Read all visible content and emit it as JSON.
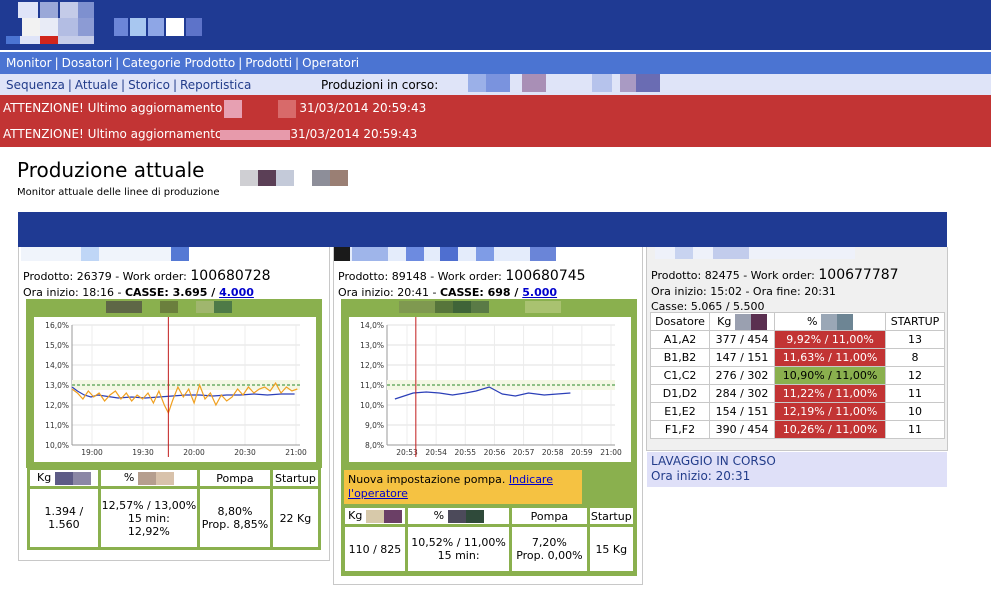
{
  "nav": {
    "main": [
      "Monitor",
      "Dosatori",
      "Categorie Prodotto",
      "Prodotti",
      "Operatori"
    ],
    "sub": [
      "Sequenza",
      "Attuale",
      "Storico",
      "Reportistica"
    ],
    "production_label": "Produzioni in corso:"
  },
  "alerts": [
    {
      "prefix": "ATTENZIONE! Ultimo aggiornamento",
      "time": "31/03/2014 20:59:43"
    },
    {
      "prefix": "ATTENZIONE! Ultimo aggiornamento",
      "time": "31/03/2014 20:59:43"
    }
  ],
  "page": {
    "title": "Produzione attuale",
    "subtitle": "Monitor attuale delle linee di produzione"
  },
  "lines": [
    {
      "prodotto": "Prodotto: 26379 - Work order:",
      "work_order": "100680728",
      "ora_inizio": "Ora inizio: 18:16 - ",
      "casse_label": "CASSE: 3.695 / ",
      "casse_target": "4.000",
      "kg_label": "Kg",
      "pct_label": "%",
      "pompa_label": "Pompa",
      "startup_label": "Startup",
      "kg_value": "1.394 / 1.560",
      "pct_value": "12,57% / 13,00%",
      "pct_15": "15 min:",
      "pct_15_value": "12,92%",
      "pompa_value": "8,80%",
      "pompa_prop": "Prop. 8,85%",
      "startup_value": "22 Kg"
    },
    {
      "prodotto": "Prodotto: 89148 - Work order:",
      "work_order": "100680745",
      "ora_inizio": "Ora inizio: 20:41 - ",
      "casse_label": "CASSE: 698 / ",
      "casse_target": "5.000",
      "notice_text": "Nuova impostazione pompa.",
      "notice_link": "Indicare l'operatore",
      "kg_label": "Kg",
      "pct_label": "%",
      "pompa_label": "Pompa",
      "startup_label": "Startup",
      "kg_value": "110 / 825",
      "pct_value": "10,52% / 11,00%",
      "pct_15": "15 min:",
      "pompa_value": "7,20%",
      "pompa_prop": "Prop. 0,00%",
      "startup_value": "15 Kg"
    },
    {
      "prodotto": "Prodotto: 82475 - Work order:",
      "work_order": "100677787",
      "ora_inizio": "Ora inizio: 15:02 - Ora fine: 20:31",
      "casse": "Casse: 5.065 / 5.500",
      "headers": [
        "Dosatore",
        "Kg",
        "%",
        "STARTUP"
      ],
      "rows": [
        {
          "dosatore": "A1,A2",
          "kg": "377 / 454",
          "pct": "9,92% / 11,00%",
          "status": "red",
          "startup": "13"
        },
        {
          "dosatore": "B1,B2",
          "kg": "147 / 151",
          "pct": "11,63% / 11,00%",
          "status": "red",
          "startup": "8"
        },
        {
          "dosatore": "C1,C2",
          "kg": "276 / 302",
          "pct": "10,90% / 11,00%",
          "status": "green",
          "startup": "12"
        },
        {
          "dosatore": "D1,D2",
          "kg": "284 / 302",
          "pct": "11,22% / 11,00%",
          "status": "red",
          "startup": "11"
        },
        {
          "dosatore": "E1,E2",
          "kg": "154 / 151",
          "pct": "12,19% / 11,00%",
          "status": "red",
          "startup": "10"
        },
        {
          "dosatore": "F1,F2",
          "kg": "390 / 454",
          "pct": "10,26% / 11,00%",
          "status": "red",
          "startup": "11"
        }
      ],
      "wash_status": "LAVAGGIO IN CORSO",
      "wash_start": "Ora inizio: 20:31"
    }
  ],
  "chart_data": [
    {
      "type": "line",
      "ylim": [
        10,
        16
      ],
      "yticks": [
        "16,0%",
        "15,0%",
        "14,0%",
        "13,0%",
        "12,0%",
        "11,0%",
        "10,0%"
      ],
      "xticks": [
        "19:00",
        "19:30",
        "20:00",
        "20:30",
        "21:00"
      ],
      "xlim_minutes": [
        1096,
        1264
      ],
      "marker_time_minutes": 1167,
      "target": 13.0,
      "series": [
        {
          "color": "#2b3fb8",
          "x": [
            1096,
            1100,
            1105,
            1110,
            1115,
            1120,
            1130,
            1140,
            1150,
            1160,
            1170,
            1180,
            1190,
            1200,
            1210,
            1220,
            1230,
            1240,
            1250,
            1260
          ],
          "y": [
            12.9,
            12.7,
            12.5,
            12.4,
            12.5,
            12.45,
            12.35,
            12.4,
            12.35,
            12.4,
            12.45,
            12.5,
            12.5,
            12.45,
            12.5,
            12.5,
            12.55,
            12.5,
            12.55,
            12.55
          ]
        },
        {
          "color": "#f0a020",
          "x": [
            1096,
            1100,
            1104,
            1108,
            1112,
            1116,
            1120,
            1124,
            1128,
            1132,
            1136,
            1140,
            1144,
            1148,
            1152,
            1156,
            1160,
            1164,
            1167,
            1170,
            1174,
            1178,
            1182,
            1186,
            1190,
            1194,
            1198,
            1202,
            1206,
            1210,
            1214,
            1218,
            1222,
            1226,
            1230,
            1234,
            1238,
            1242,
            1246,
            1250,
            1254,
            1258,
            1262
          ],
          "y": [
            12.8,
            12.6,
            12.3,
            12.7,
            12.4,
            12.6,
            12.2,
            12.5,
            12.7,
            12.3,
            12.6,
            12.2,
            12.5,
            12.3,
            12.6,
            12.1,
            12.7,
            12.0,
            11.6,
            12.2,
            12.9,
            12.4,
            12.8,
            12.1,
            13.0,
            12.3,
            12.6,
            12.0,
            12.5,
            12.2,
            12.4,
            12.8,
            12.5,
            12.9,
            12.6,
            12.8,
            12.9,
            12.7,
            13.1,
            12.6,
            12.9,
            12.7,
            12.8
          ]
        }
      ]
    },
    {
      "type": "line",
      "ylim": [
        8,
        14
      ],
      "yticks": [
        "14,0%",
        "13,0%",
        "12,0%",
        "11,0%",
        "10,0%",
        "9,0%",
        "8,0%"
      ],
      "xticks": [
        "20:53",
        "20:54",
        "20:55",
        "20:56",
        "20:57",
        "20:58",
        "20:59",
        "21:00"
      ],
      "xlim_minutes": [
        1252.3,
        1261.0
      ],
      "marker_time_minutes": 1253.4,
      "target": 11.0,
      "series": [
        {
          "color": "#2b3fb8",
          "x": [
            1252.6,
            1253.3,
            1253.8,
            1254.3,
            1254.8,
            1255.3,
            1255.7,
            1256.2,
            1256.7,
            1257.2,
            1257.7,
            1258.3,
            1258.8,
            1259.3
          ],
          "y": [
            10.3,
            10.6,
            10.65,
            10.6,
            10.5,
            10.6,
            10.7,
            10.9,
            10.55,
            10.45,
            10.6,
            10.5,
            10.55,
            10.6
          ]
        }
      ]
    }
  ]
}
